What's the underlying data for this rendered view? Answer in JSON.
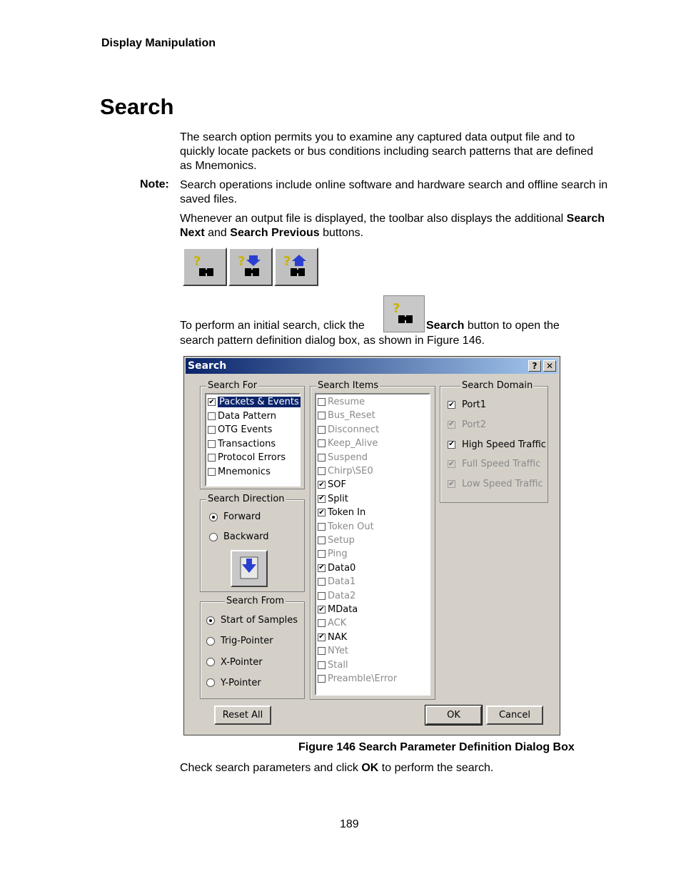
{
  "header": "Display Manipulation",
  "title": "Search",
  "intro": "The search option permits you to examine any captured data output file and to quickly locate packets or bus conditions including search patterns that are defined as Mnemonics.",
  "note": {
    "label": "Note:",
    "text": "Search operations include online software and hardware search and offline search in saved files."
  },
  "toolbar_para": {
    "before": "Whenever an output file is displayed, the toolbar also displays the additional ",
    "b1": "Search Next",
    "mid": " and ",
    "b2": "Search Previous",
    "after": " buttons."
  },
  "toolbar_icons": [
    "search-icon",
    "search-next-icon",
    "search-previous-icon"
  ],
  "initial_para": {
    "before": "To perform an initial search, click the",
    "bold": "Search",
    "after": " button to open the",
    "line2": "search pattern definition dialog box, as shown in Figure 146."
  },
  "dialog": {
    "title": "Search",
    "help_btn": "?",
    "close_btn": "✕",
    "search_for": {
      "label": "Search For",
      "items": [
        {
          "label": "Packets & Events",
          "checked": true,
          "selected": true
        },
        {
          "label": "Data Pattern",
          "checked": false
        },
        {
          "label": "OTG Events",
          "checked": false
        },
        {
          "label": "Transactions",
          "checked": false
        },
        {
          "label": "Protocol Errors",
          "checked": false
        },
        {
          "label": "Mnemonics",
          "checked": false
        }
      ]
    },
    "search_direction": {
      "label": "Search Direction",
      "options": [
        {
          "label": "Forward",
          "selected": true
        },
        {
          "label": "Backward",
          "selected": false
        }
      ]
    },
    "search_from": {
      "label": "Search From",
      "options": [
        {
          "label": "Start of Samples",
          "selected": true
        },
        {
          "label": "Trig-Pointer",
          "selected": false
        },
        {
          "label": "X-Pointer",
          "selected": false
        },
        {
          "label": "Y-Pointer",
          "selected": false
        }
      ]
    },
    "search_items": {
      "label": "Search Items",
      "items": [
        {
          "label": "Resume",
          "checked": false
        },
        {
          "label": "Bus_Reset",
          "checked": false
        },
        {
          "label": "Disconnect",
          "checked": false
        },
        {
          "label": "Keep_Alive",
          "checked": false
        },
        {
          "label": "Suspend",
          "checked": false
        },
        {
          "label": "Chirp\\SE0",
          "checked": false
        },
        {
          "label": "SOF",
          "checked": true
        },
        {
          "label": "Split",
          "checked": true
        },
        {
          "label": "Token In",
          "checked": true
        },
        {
          "label": "Token Out",
          "checked": false
        },
        {
          "label": "Setup",
          "checked": false
        },
        {
          "label": "Ping",
          "checked": false
        },
        {
          "label": "Data0",
          "checked": true
        },
        {
          "label": "Data1",
          "checked": false
        },
        {
          "label": "Data2",
          "checked": false
        },
        {
          "label": "MData",
          "checked": true
        },
        {
          "label": "ACK",
          "checked": false
        },
        {
          "label": "NAK",
          "checked": true
        },
        {
          "label": "NYet",
          "checked": false
        },
        {
          "label": "Stall",
          "checked": false
        },
        {
          "label": "Preamble\\Error",
          "checked": false
        }
      ]
    },
    "search_domain": {
      "label": "Search Domain",
      "items": [
        {
          "label": "Port1",
          "checked": true,
          "disabled": false
        },
        {
          "label": "Port2",
          "checked": true,
          "disabled": true
        },
        {
          "label": "High Speed Traffic",
          "checked": true,
          "disabled": false
        },
        {
          "label": "Full  Speed Traffic",
          "checked": true,
          "disabled": true
        },
        {
          "label": "Low  Speed Traffic",
          "checked": true,
          "disabled": true
        }
      ]
    },
    "reset_label": "Reset All",
    "ok_label": "OK",
    "cancel_label": "Cancel"
  },
  "caption": "Figure  146  Search Parameter Definition Dialog Box",
  "closing": {
    "before": "Check search parameters and click ",
    "bold": "OK",
    "after": " to perform the search."
  },
  "page_number": "189"
}
